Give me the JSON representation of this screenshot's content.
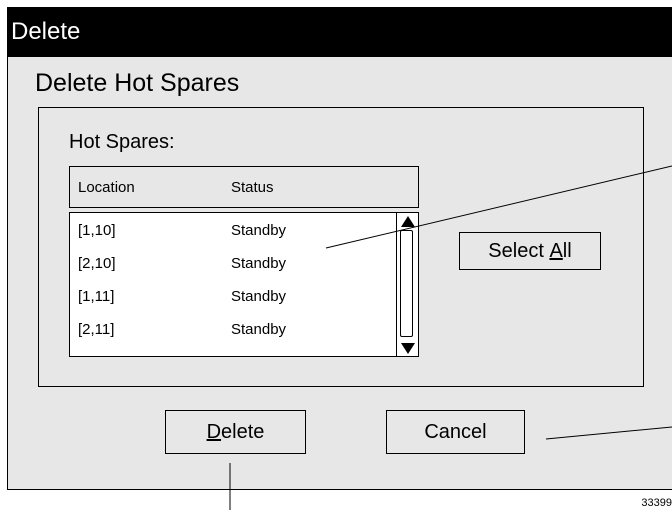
{
  "window": {
    "title": "Delete"
  },
  "dialog": {
    "heading": "Delete Hot Spares",
    "group_label": "Hot Spares:",
    "columns": [
      "Location",
      "Status"
    ],
    "rows": [
      {
        "location": "[1,10]",
        "status": "Standby"
      },
      {
        "location": "[2,10]",
        "status": "Standby"
      },
      {
        "location": "[1,11]",
        "status": "Standby"
      },
      {
        "location": "[2,11]",
        "status": "Standby"
      }
    ],
    "select_all": {
      "prefix": "Select ",
      "mnemonic": "A",
      "suffix": "ll"
    },
    "delete": {
      "mnemonic": "D",
      "suffix": "elete"
    },
    "cancel_label": "Cancel"
  },
  "figure_number": "33399",
  "icons": {
    "scroll_up": "arrow-up-icon",
    "scroll_down": "arrow-down-icon"
  }
}
